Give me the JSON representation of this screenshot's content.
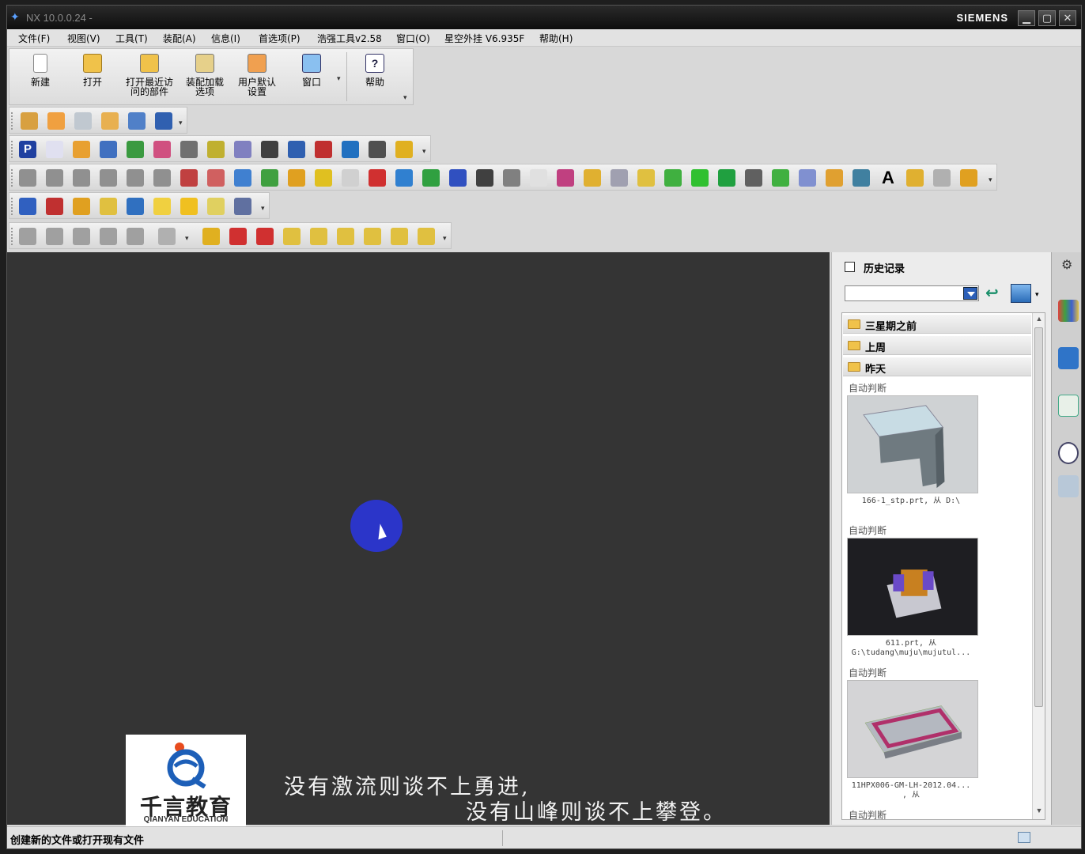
{
  "titlebar": {
    "title": "NX 10.0.0.24 -",
    "brand": "SIEMENS",
    "minimize": "▁",
    "maximize": "▢",
    "close": "✕"
  },
  "menu": [
    "文件(F)",
    "视图(V)",
    "工具(T)",
    "装配(A)",
    "信息(I)",
    "首选项(P)",
    "浩强工具v2.58",
    "窗口(O)",
    "星空外挂 V6.935F",
    "帮助(H)"
  ],
  "bigbar": {
    "new": "新建",
    "open": "打开",
    "recent_line1": "打开最近访",
    "recent_line2": "问的部件",
    "asm_line1": "装配加载",
    "asm_line2": "选项",
    "user_line1": "用户默认",
    "user_line2": "设置",
    "window": "窗口",
    "help": "帮助"
  },
  "icon_colors": [
    "#e8a020",
    "#2a70c8",
    "#3aa040",
    "#c83030",
    "#8a50c0",
    "#20a0b0",
    "#d8c020",
    "#707070"
  ],
  "viewport": {
    "logo_cn": "千言教育",
    "logo_en": "QIANYAN EDUCATION",
    "subtitle_line1": "没有激流则谈不上勇进,",
    "subtitle_line2": "没有山峰则谈不上攀登。"
  },
  "history": {
    "title": "历史记录",
    "combo_value": "",
    "groups": [
      "三星期之前",
      "上周",
      "昨天"
    ],
    "items": [
      {
        "category": "自动判断",
        "caption1": "166-1_stp.prt, 从 D:\\",
        "caption2": ""
      },
      {
        "category": "自动判断",
        "caption1": "611.prt, 从",
        "caption2": "G:\\tudang\\muju\\mujutul..."
      },
      {
        "category": "自动判断",
        "caption1": "11HPX006-GM-LH-2012.04...",
        "caption2": ", 从"
      },
      {
        "category": "自动判断",
        "caption1": "",
        "caption2": ""
      }
    ]
  },
  "status": {
    "message": "创建新的文件或打开现有文件"
  }
}
